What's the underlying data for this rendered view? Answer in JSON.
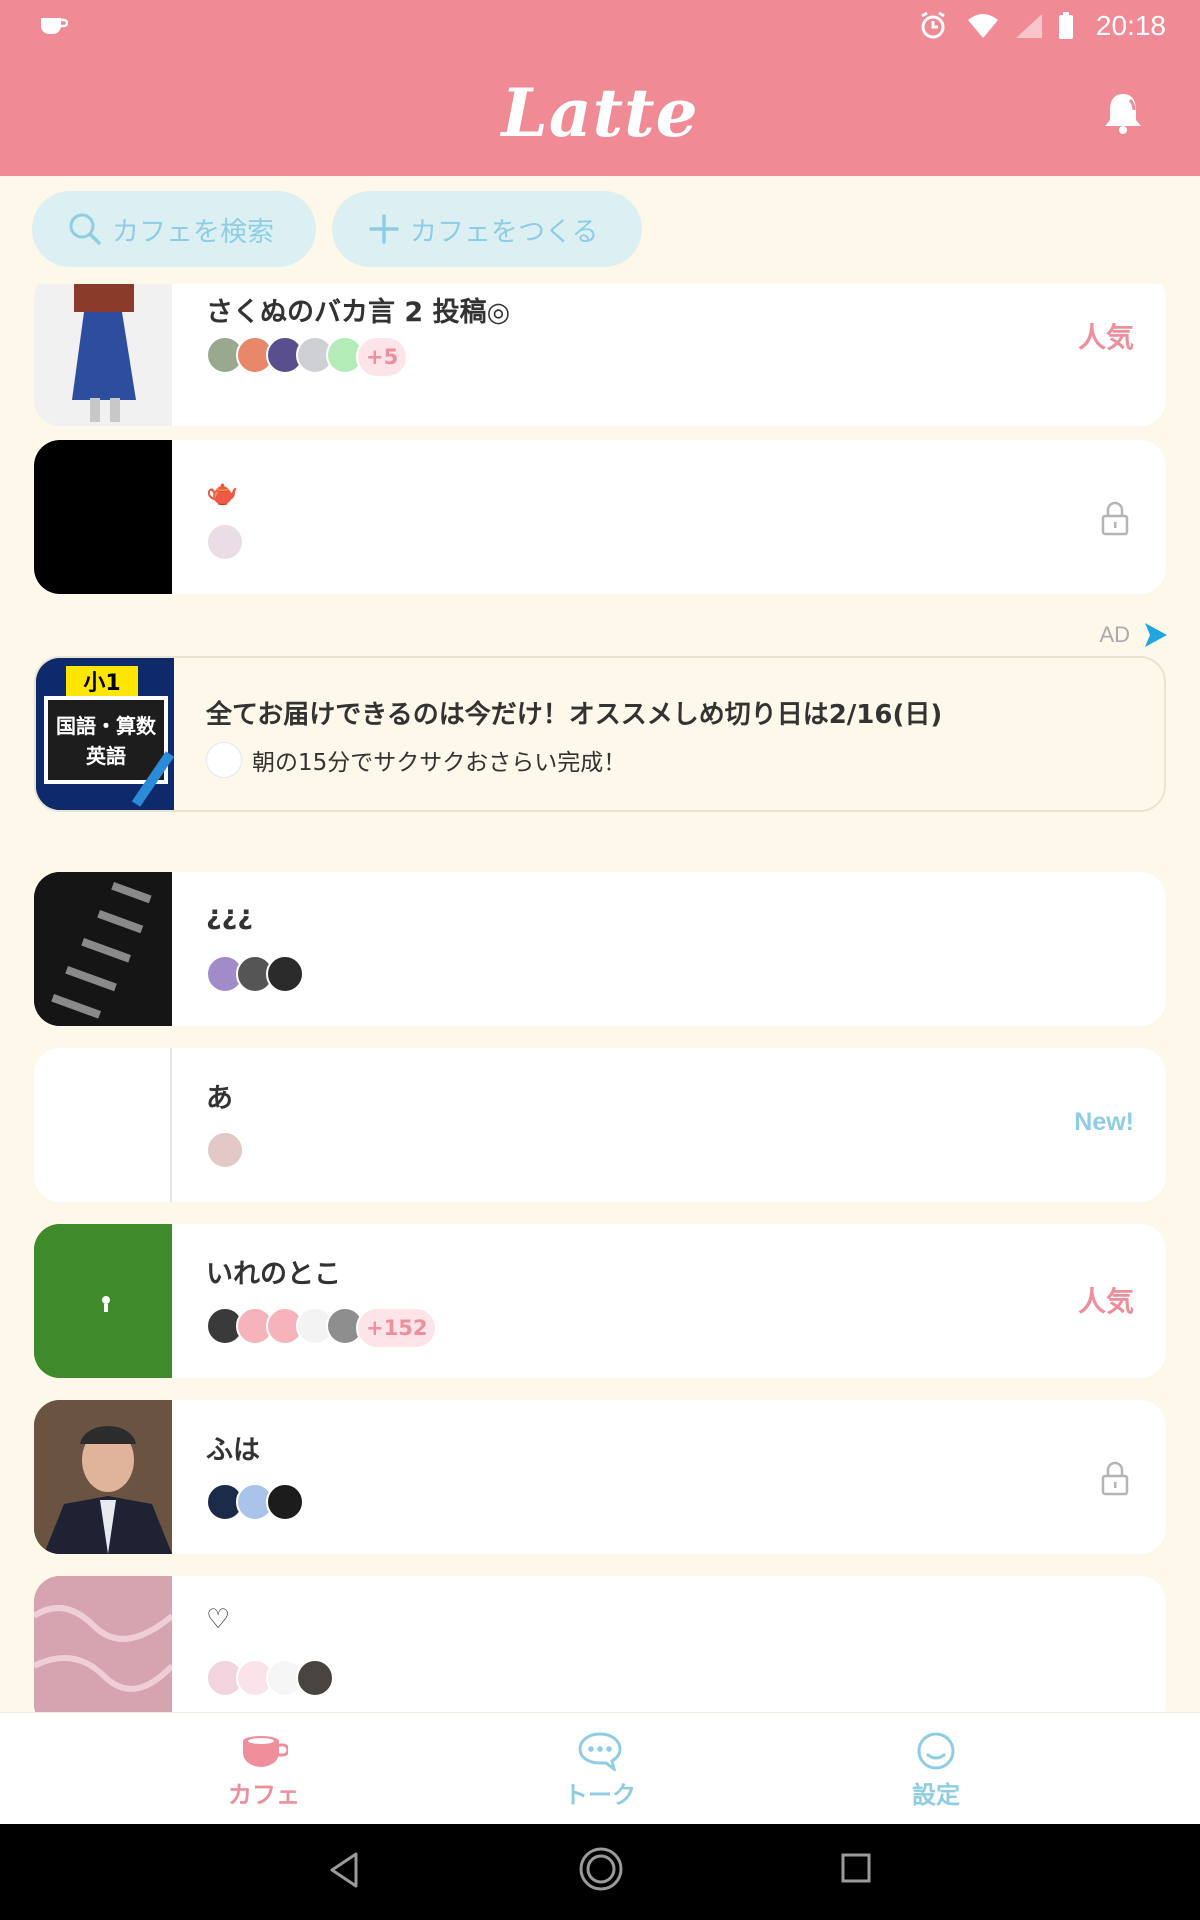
{
  "status_bar": {
    "time": "20:18"
  },
  "header": {
    "logo": "Latte"
  },
  "actions": {
    "search_label": "カフェを検索",
    "create_label": "カフェをつくる"
  },
  "cafes": [
    {
      "title": "さくぬのバカ言 2 投稿◎",
      "more": "+5",
      "badge": "人気"
    },
    {
      "title": "🫖"
    },
    {
      "title": "¿¿¿"
    },
    {
      "title": "あ",
      "badge": "New!"
    },
    {
      "title": "いれのとこ",
      "more": "+152",
      "badge": "人気"
    },
    {
      "title": "ふは"
    },
    {
      "title": "♡"
    }
  ],
  "ad": {
    "label": "AD",
    "thumb_badge": "小1",
    "thumb_line1": "国語・算数",
    "thumb_line2": "英語",
    "title": "全てお届けできるのは今だけ！オススメしめ切り日は2/16(日)",
    "subtitle": "朝の15分でサクサクおさらい完成！"
  },
  "bottom_nav": {
    "cafe": "カフェ",
    "talk": "トーク",
    "settings": "設定"
  },
  "colors": {
    "brand_pink": "#f08a95",
    "accent_blue": "#8fcde3",
    "background": "#fdf8e9"
  },
  "icons": [
    "cup-icon",
    "bell-icon",
    "search-icon",
    "plus-icon",
    "lock-icon",
    "ad-play-icon",
    "chat-icon",
    "smiley-icon",
    "back-icon",
    "home-icon",
    "recents-icon"
  ]
}
